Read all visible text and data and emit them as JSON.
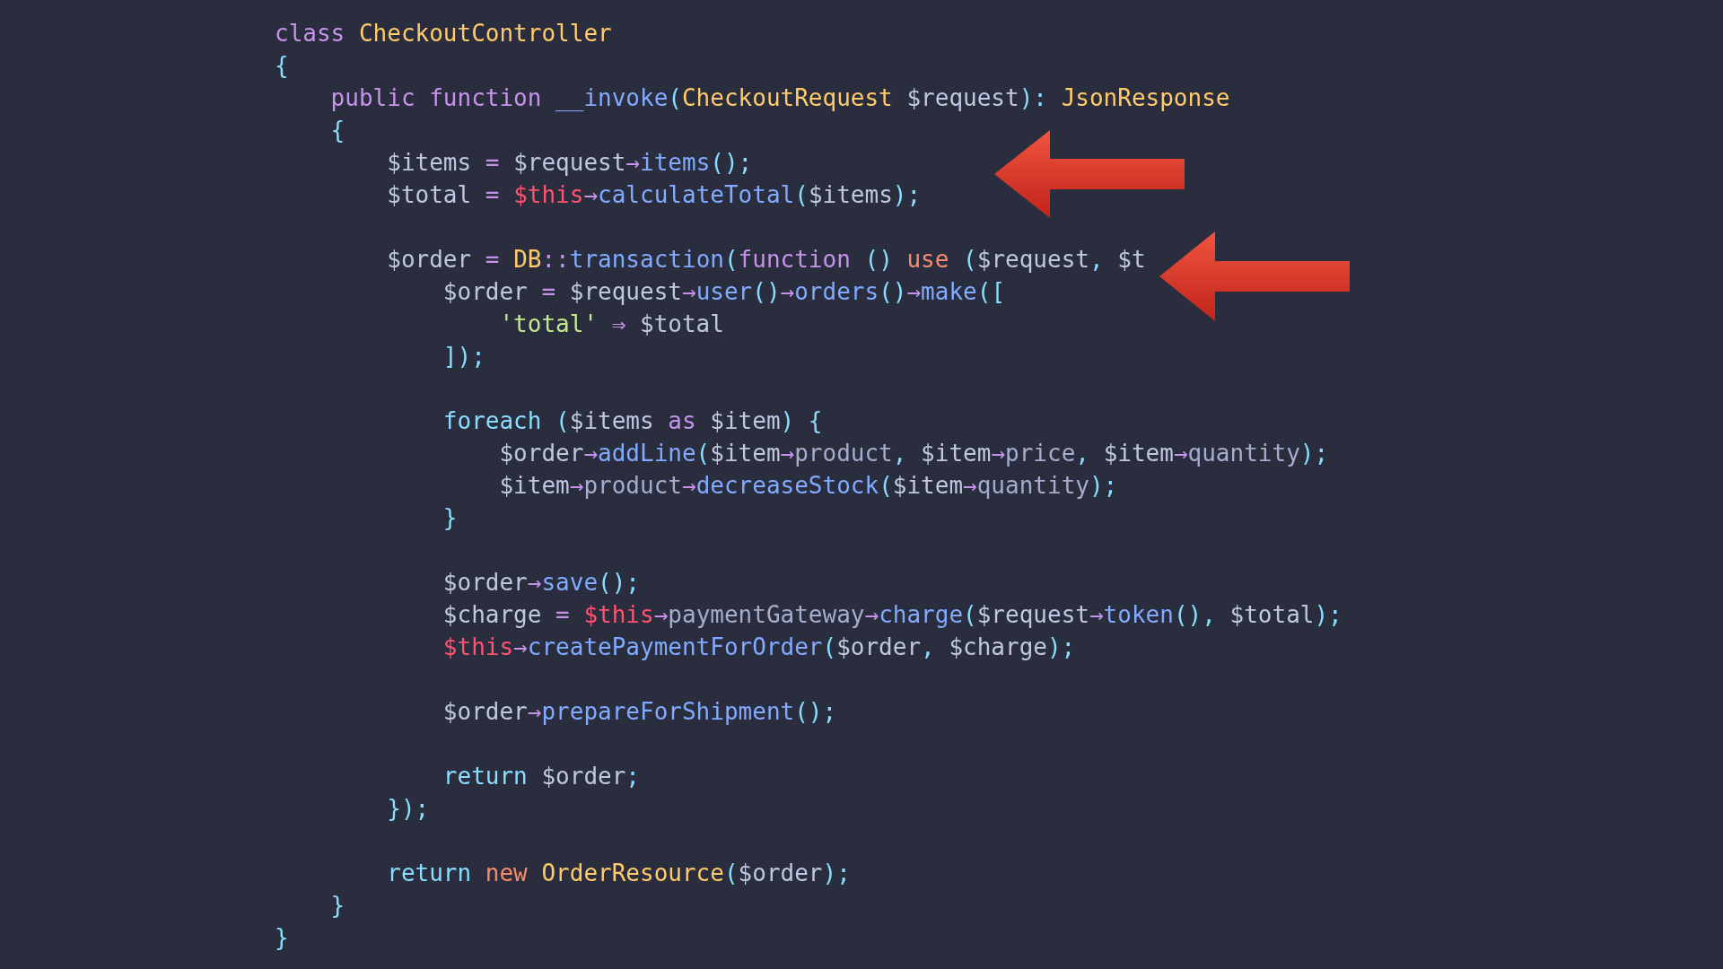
{
  "code": {
    "lines": [
      {
        "kind": "code",
        "tokens": [
          {
            "text": "class ",
            "kind": "kw"
          },
          {
            "text": "CheckoutController",
            "kind": "type"
          }
        ]
      },
      {
        "kind": "code",
        "tokens": [
          {
            "text": "{",
            "kind": "punct"
          }
        ]
      },
      {
        "kind": "code",
        "tokens": [
          {
            "text": "    public function ",
            "kind": "kw"
          },
          {
            "text": "__invoke",
            "kind": "fn"
          },
          {
            "text": "(",
            "kind": "punct"
          },
          {
            "text": "CheckoutRequest ",
            "kind": "type"
          },
          {
            "text": "$request",
            "kind": "var"
          },
          {
            "text": "): ",
            "kind": "punct"
          },
          {
            "text": "JsonResponse",
            "kind": "type"
          }
        ]
      },
      {
        "kind": "code",
        "tokens": [
          {
            "text": "    {",
            "kind": "punct"
          }
        ]
      },
      {
        "kind": "code",
        "tokens": [
          {
            "text": "        $items ",
            "kind": "var"
          },
          {
            "text": "= ",
            "kind": "op"
          },
          {
            "text": "$request",
            "kind": "var"
          },
          {
            "text": "→",
            "kind": "op"
          },
          {
            "text": "items",
            "kind": "fn"
          },
          {
            "text": "();",
            "kind": "punct"
          }
        ]
      },
      {
        "kind": "code",
        "tokens": [
          {
            "text": "        $total ",
            "kind": "var"
          },
          {
            "text": "= ",
            "kind": "op"
          },
          {
            "text": "$this",
            "kind": "this"
          },
          {
            "text": "→",
            "kind": "op"
          },
          {
            "text": "calculateTotal",
            "kind": "fn"
          },
          {
            "text": "(",
            "kind": "punct"
          },
          {
            "text": "$items",
            "kind": "var"
          },
          {
            "text": ");",
            "kind": "punct"
          }
        ]
      },
      {
        "kind": "blank"
      },
      {
        "kind": "code",
        "tokens": [
          {
            "text": "        $order ",
            "kind": "var"
          },
          {
            "text": "= ",
            "kind": "op"
          },
          {
            "text": "DB",
            "kind": "type"
          },
          {
            "text": "::",
            "kind": "op"
          },
          {
            "text": "transaction",
            "kind": "fn"
          },
          {
            "text": "(",
            "kind": "punct"
          },
          {
            "text": "function ",
            "kind": "kw"
          },
          {
            "text": "() ",
            "kind": "punct"
          },
          {
            "text": "use ",
            "kind": "kw2"
          },
          {
            "text": "(",
            "kind": "punct"
          },
          {
            "text": "$request",
            "kind": "var"
          },
          {
            "text": ", ",
            "kind": "punct"
          },
          {
            "text": "$t",
            "kind": "var"
          }
        ]
      },
      {
        "kind": "code",
        "tokens": [
          {
            "text": "            $order ",
            "kind": "var"
          },
          {
            "text": "= ",
            "kind": "op"
          },
          {
            "text": "$request",
            "kind": "var"
          },
          {
            "text": "→",
            "kind": "op"
          },
          {
            "text": "user",
            "kind": "fn"
          },
          {
            "text": "()",
            "kind": "punct"
          },
          {
            "text": "→",
            "kind": "op"
          },
          {
            "text": "orders",
            "kind": "fn"
          },
          {
            "text": "()",
            "kind": "punct"
          },
          {
            "text": "→",
            "kind": "op"
          },
          {
            "text": "make",
            "kind": "fn"
          },
          {
            "text": "([",
            "kind": "punct"
          }
        ]
      },
      {
        "kind": "code",
        "tokens": [
          {
            "text": "                'total' ",
            "kind": "str"
          },
          {
            "text": "⇒ ",
            "kind": "op"
          },
          {
            "text": "$total",
            "kind": "var"
          }
        ]
      },
      {
        "kind": "code",
        "tokens": [
          {
            "text": "            ]);",
            "kind": "punct"
          }
        ]
      },
      {
        "kind": "blank"
      },
      {
        "kind": "code",
        "tokens": [
          {
            "text": "            foreach ",
            "kind": "ctrl"
          },
          {
            "text": "(",
            "kind": "punct"
          },
          {
            "text": "$items ",
            "kind": "var"
          },
          {
            "text": "as ",
            "kind": "kw"
          },
          {
            "text": "$item",
            "kind": "var"
          },
          {
            "text": ") {",
            "kind": "punct"
          }
        ]
      },
      {
        "kind": "code",
        "tokens": [
          {
            "text": "                $order",
            "kind": "var"
          },
          {
            "text": "→",
            "kind": "op"
          },
          {
            "text": "addLine",
            "kind": "fn"
          },
          {
            "text": "(",
            "kind": "punct"
          },
          {
            "text": "$item",
            "kind": "var"
          },
          {
            "text": "→",
            "kind": "op"
          },
          {
            "text": "product",
            "kind": "prop"
          },
          {
            "text": ", ",
            "kind": "punct"
          },
          {
            "text": "$item",
            "kind": "var"
          },
          {
            "text": "→",
            "kind": "op"
          },
          {
            "text": "price",
            "kind": "prop"
          },
          {
            "text": ", ",
            "kind": "punct"
          },
          {
            "text": "$item",
            "kind": "var"
          },
          {
            "text": "→",
            "kind": "op"
          },
          {
            "text": "quantity",
            "kind": "prop"
          },
          {
            "text": ");",
            "kind": "punct"
          }
        ]
      },
      {
        "kind": "code",
        "tokens": [
          {
            "text": "                $item",
            "kind": "var"
          },
          {
            "text": "→",
            "kind": "op"
          },
          {
            "text": "product",
            "kind": "prop"
          },
          {
            "text": "→",
            "kind": "op"
          },
          {
            "text": "decreaseStock",
            "kind": "fn"
          },
          {
            "text": "(",
            "kind": "punct"
          },
          {
            "text": "$item",
            "kind": "var"
          },
          {
            "text": "→",
            "kind": "op"
          },
          {
            "text": "quantity",
            "kind": "prop"
          },
          {
            "text": ");",
            "kind": "punct"
          }
        ]
      },
      {
        "kind": "code",
        "tokens": [
          {
            "text": "            }",
            "kind": "punct"
          }
        ]
      },
      {
        "kind": "blank"
      },
      {
        "kind": "code",
        "tokens": [
          {
            "text": "            $order",
            "kind": "var"
          },
          {
            "text": "→",
            "kind": "op"
          },
          {
            "text": "save",
            "kind": "fn"
          },
          {
            "text": "();",
            "kind": "punct"
          }
        ]
      },
      {
        "kind": "code",
        "tokens": [
          {
            "text": "            $charge ",
            "kind": "var"
          },
          {
            "text": "= ",
            "kind": "op"
          },
          {
            "text": "$this",
            "kind": "this"
          },
          {
            "text": "→",
            "kind": "op"
          },
          {
            "text": "paymentGateway",
            "kind": "prop"
          },
          {
            "text": "→",
            "kind": "op"
          },
          {
            "text": "charge",
            "kind": "fn"
          },
          {
            "text": "(",
            "kind": "punct"
          },
          {
            "text": "$request",
            "kind": "var"
          },
          {
            "text": "→",
            "kind": "op"
          },
          {
            "text": "token",
            "kind": "fn"
          },
          {
            "text": "(), ",
            "kind": "punct"
          },
          {
            "text": "$total",
            "kind": "var"
          },
          {
            "text": ");",
            "kind": "punct"
          }
        ]
      },
      {
        "kind": "code",
        "tokens": [
          {
            "text": "            $this",
            "kind": "this"
          },
          {
            "text": "→",
            "kind": "op"
          },
          {
            "text": "createPaymentForOrder",
            "kind": "fn"
          },
          {
            "text": "(",
            "kind": "punct"
          },
          {
            "text": "$order",
            "kind": "var"
          },
          {
            "text": ", ",
            "kind": "punct"
          },
          {
            "text": "$charge",
            "kind": "var"
          },
          {
            "text": ");",
            "kind": "punct"
          }
        ]
      },
      {
        "kind": "blank"
      },
      {
        "kind": "code",
        "tokens": [
          {
            "text": "            $order",
            "kind": "var"
          },
          {
            "text": "→",
            "kind": "op"
          },
          {
            "text": "prepareForShipment",
            "kind": "fn"
          },
          {
            "text": "();",
            "kind": "punct"
          }
        ]
      },
      {
        "kind": "blank"
      },
      {
        "kind": "code",
        "tokens": [
          {
            "text": "            return ",
            "kind": "ctrl"
          },
          {
            "text": "$order",
            "kind": "var"
          },
          {
            "text": ";",
            "kind": "punct"
          }
        ]
      },
      {
        "kind": "code",
        "tokens": [
          {
            "text": "        });",
            "kind": "punct"
          }
        ]
      },
      {
        "kind": "blank"
      },
      {
        "kind": "code",
        "tokens": [
          {
            "text": "        return ",
            "kind": "ctrl"
          },
          {
            "text": "new ",
            "kind": "kw2"
          },
          {
            "text": "OrderResource",
            "kind": "type"
          },
          {
            "text": "(",
            "kind": "punct"
          },
          {
            "text": "$order",
            "kind": "var"
          },
          {
            "text": ");",
            "kind": "punct"
          }
        ]
      },
      {
        "kind": "code",
        "tokens": [
          {
            "text": "    }",
            "kind": "punct"
          }
        ]
      },
      {
        "kind": "code",
        "tokens": [
          {
            "text": "}",
            "kind": "punct"
          }
        ]
      }
    ]
  }
}
